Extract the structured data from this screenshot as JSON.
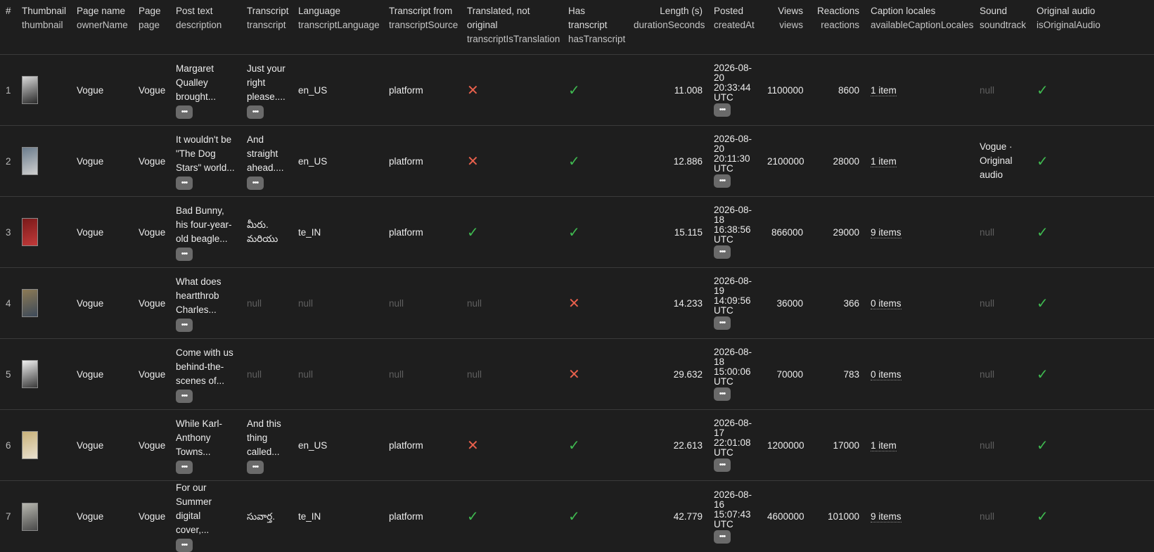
{
  "columns": [
    {
      "label": "#",
      "api": ""
    },
    {
      "label": "Thumbnail",
      "api": "thumbnail"
    },
    {
      "label": "Page name",
      "api": "ownerName"
    },
    {
      "label": "Page",
      "api": "page"
    },
    {
      "label": "Post text",
      "api": "description"
    },
    {
      "label": "Transcript",
      "api": "transcript"
    },
    {
      "label": "Language",
      "api": "transcriptLanguage"
    },
    {
      "label": "Transcript from",
      "api": "transcriptSource"
    },
    {
      "label": "Translated, not original",
      "api": "transcriptIsTranslation"
    },
    {
      "label": "Has transcript",
      "api": "hasTranscript"
    },
    {
      "label": "Length (s)",
      "api": "durationSeconds"
    },
    {
      "label": "Posted",
      "api": "createdAt"
    },
    {
      "label": "Views",
      "api": "views"
    },
    {
      "label": "Reactions",
      "api": "reactions"
    },
    {
      "label": "Caption locales",
      "api": "availableCaptionLocales"
    },
    {
      "label": "Sound",
      "api": "soundtrack"
    },
    {
      "label": "Original audio",
      "api": "isOriginalAudio"
    }
  ],
  "null_text": "null",
  "more_label": "•••",
  "icons": {
    "check": "check-icon",
    "cross": "cross-icon",
    "more": "ellipsis-icon"
  },
  "colors": {
    "check": "#3fb950",
    "cross": "#e8604c",
    "null": "#5f5f5f",
    "background": "#1e1e1e"
  },
  "rows": [
    {
      "index": "1",
      "thumb_colors": [
        "#d9d9d9",
        "#2a2a2a"
      ],
      "ownerName": "Vogue",
      "page": "Vogue",
      "description": [
        "Margaret",
        "Qualley",
        "brought..."
      ],
      "transcript": [
        "Just your",
        "right",
        "please...."
      ],
      "transcriptLanguage": "en_US",
      "transcriptSource": "platform",
      "transcriptIsTranslation": false,
      "hasTranscript": true,
      "durationSeconds": "11.008",
      "createdAt": [
        "2026-08-20",
        "20:33:44",
        "UTC"
      ],
      "views": "1100000",
      "reactions": "8600",
      "availableCaptionLocales": "1 item",
      "soundtrack": null,
      "isOriginalAudio": true
    },
    {
      "index": "2",
      "thumb_colors": [
        "#6b7c8c",
        "#cfcfcf"
      ],
      "ownerName": "Vogue",
      "page": "Vogue",
      "description": [
        "It wouldn't be",
        "\"The Dog",
        "Stars\" world..."
      ],
      "transcript": [
        "And",
        "straight",
        "ahead...."
      ],
      "transcriptLanguage": "en_US",
      "transcriptSource": "platform",
      "transcriptIsTranslation": false,
      "hasTranscript": true,
      "durationSeconds": "12.886",
      "createdAt": [
        "2026-08-20",
        "20:11:30",
        "UTC"
      ],
      "views": "2100000",
      "reactions": "28000",
      "availableCaptionLocales": "1 item",
      "soundtrack": [
        "Vogue ·",
        "Original",
        "audio"
      ],
      "isOriginalAudio": true
    },
    {
      "index": "3",
      "thumb_colors": [
        "#7a1a1a",
        "#c23a3a"
      ],
      "ownerName": "Vogue",
      "page": "Vogue",
      "description": [
        "Bad Bunny,",
        "his four-year-",
        "old beagle..."
      ],
      "transcript": [
        "మీరు.",
        "మరియు"
      ],
      "transcriptLanguage": "te_IN",
      "transcriptSource": "platform",
      "transcriptIsTranslation": true,
      "hasTranscript": true,
      "durationSeconds": "15.115",
      "createdAt": [
        "2026-08-18",
        "16:38:56",
        "UTC"
      ],
      "views": "866000",
      "reactions": "29000",
      "availableCaptionLocales": "9 items",
      "soundtrack": null,
      "isOriginalAudio": true
    },
    {
      "index": "4",
      "thumb_colors": [
        "#8c7a55",
        "#3d4a5a"
      ],
      "ownerName": "Vogue",
      "page": "Vogue",
      "description": [
        "What does",
        "heartthrob",
        "Charles..."
      ],
      "transcript": null,
      "transcriptLanguage": null,
      "transcriptSource": null,
      "transcriptIsTranslation": null,
      "hasTranscript": false,
      "durationSeconds": "14.233",
      "createdAt": [
        "2026-08-19",
        "14:09:56",
        "UTC"
      ],
      "views": "36000",
      "reactions": "366",
      "availableCaptionLocales": "0 items",
      "soundtrack": null,
      "isOriginalAudio": true
    },
    {
      "index": "5",
      "thumb_colors": [
        "#f0f0f0",
        "#3a3a3a"
      ],
      "ownerName": "Vogue",
      "page": "Vogue",
      "description": [
        "Come with us",
        "behind-the-",
        "scenes of..."
      ],
      "transcript": null,
      "transcriptLanguage": null,
      "transcriptSource": null,
      "transcriptIsTranslation": null,
      "hasTranscript": false,
      "durationSeconds": "29.632",
      "createdAt": [
        "2026-08-18",
        "15:00:06",
        "UTC"
      ],
      "views": "70000",
      "reactions": "783",
      "availableCaptionLocales": "0 items",
      "soundtrack": null,
      "isOriginalAudio": true
    },
    {
      "index": "6",
      "thumb_colors": [
        "#c9b27a",
        "#e8e0d0"
      ],
      "ownerName": "Vogue",
      "page": "Vogue",
      "description": [
        "While Karl-",
        "Anthony",
        "Towns..."
      ],
      "transcript": [
        "And this",
        "thing",
        "called..."
      ],
      "transcriptLanguage": "en_US",
      "transcriptSource": "platform",
      "transcriptIsTranslation": false,
      "hasTranscript": true,
      "durationSeconds": "22.613",
      "createdAt": [
        "2026-08-17",
        "22:01:08",
        "UTC"
      ],
      "views": "1200000",
      "reactions": "17000",
      "availableCaptionLocales": "1 item",
      "soundtrack": null,
      "isOriginalAudio": true
    },
    {
      "index": "7",
      "thumb_colors": [
        "#b8b8b0",
        "#4a4a4a"
      ],
      "ownerName": "Vogue",
      "page": "Vogue",
      "description": [
        "For our",
        "Summer",
        "digital cover,..."
      ],
      "transcript": [
        "సువార్త."
      ],
      "transcriptLanguage": "te_IN",
      "transcriptSource": "platform",
      "transcriptIsTranslation": true,
      "hasTranscript": true,
      "durationSeconds": "42.779",
      "createdAt": [
        "2026-08-16",
        "15:07:43",
        "UTC"
      ],
      "views": "4600000",
      "reactions": "101000",
      "availableCaptionLocales": "9 items",
      "soundtrack": null,
      "isOriginalAudio": true
    }
  ]
}
